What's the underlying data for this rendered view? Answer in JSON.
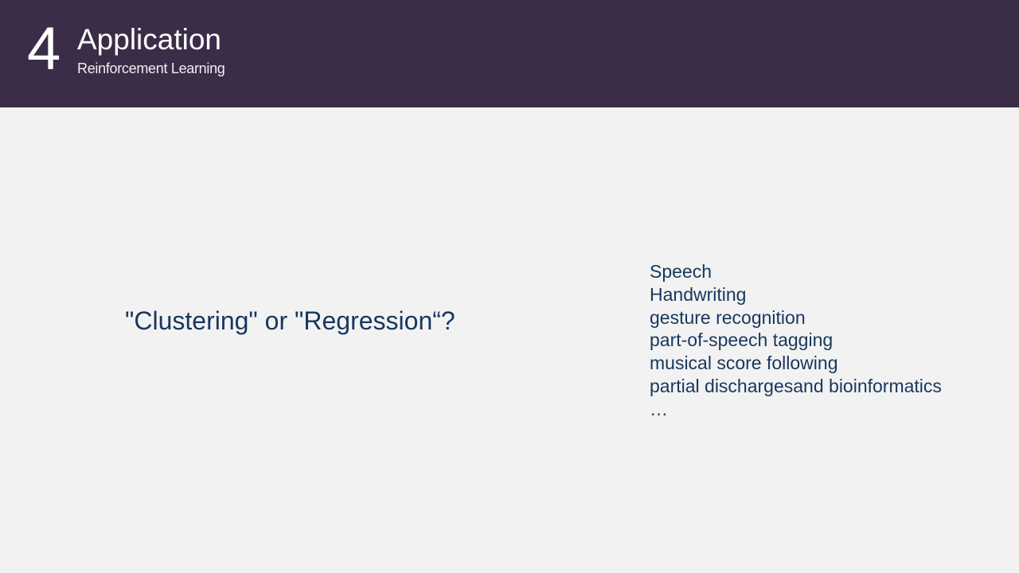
{
  "header": {
    "section_number": "4",
    "title": "Application",
    "subtitle": "Reinforcement Learning"
  },
  "main": {
    "question": "\"Clustering\" or \"Regression“?",
    "applications": [
      "Speech",
      "Handwriting",
      "gesture recognition",
      "part-of-speech tagging",
      "musical score following",
      "partial dischargesand bioinformatics",
      "…"
    ]
  },
  "colors": {
    "header_bg": "#3b2d47",
    "body_bg": "#f2f2f2",
    "text": "#17375e"
  }
}
